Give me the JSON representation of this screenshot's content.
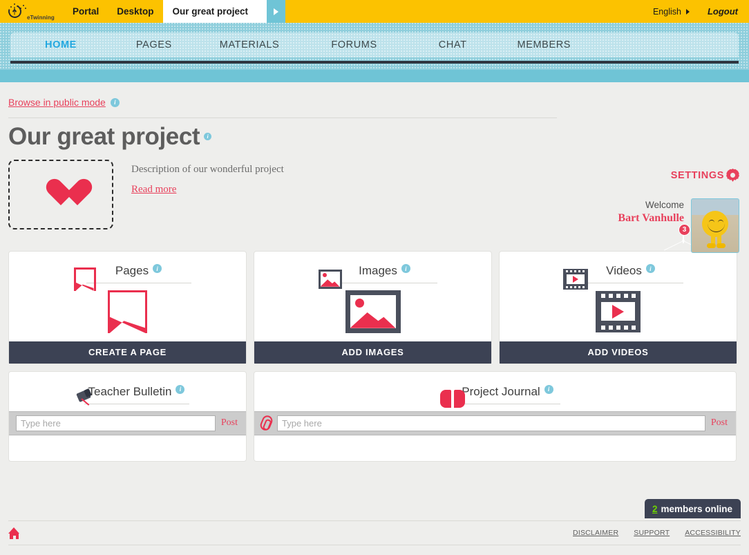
{
  "topbar": {
    "logo_text": "eTwinning",
    "items": [
      {
        "label": "Portal"
      },
      {
        "label": "Desktop"
      },
      {
        "label": "Our great project"
      }
    ],
    "tab_arrow_icon": "play-arrow-icon",
    "language": "English",
    "logout": "Logout"
  },
  "mainnav": {
    "items": [
      {
        "label": "HOME",
        "active": true
      },
      {
        "label": "PAGES",
        "active": false
      },
      {
        "label": "MATERIALS",
        "active": false
      },
      {
        "label": "FORUMS",
        "active": false
      },
      {
        "label": "CHAT",
        "active": false
      },
      {
        "label": "MEMBERS",
        "active": false
      }
    ]
  },
  "page": {
    "browse_link": "Browse in public mode",
    "browse_info": "i",
    "settings_label": "SETTINGS",
    "settings_icon": "gear-icon",
    "title": "Our great project",
    "title_info": "i",
    "cover_icon": "heart-icon",
    "description": "Description of our wonderful project",
    "read_more": "Read more"
  },
  "welcome": {
    "greeting": "Welcome",
    "name": "Bart Vanhulle",
    "messages_icon": "envelope-icon",
    "messages_count": "3",
    "avatar_icon": "avatar"
  },
  "cards": [
    {
      "title": "Pages",
      "info": "i",
      "icon": "pages-icon",
      "cta": "CREATE A PAGE"
    },
    {
      "title": "Images",
      "info": "i",
      "icon": "image-icon",
      "cta": "ADD IMAGES"
    },
    {
      "title": "Videos",
      "info": "i",
      "icon": "video-icon",
      "cta": "ADD VIDEOS"
    }
  ],
  "panels": [
    {
      "title": "Teacher Bulletin",
      "info": "i",
      "icon": "pushpin-icon",
      "input_placeholder": "Type here",
      "input_value": "",
      "post_label": "Post"
    },
    {
      "title": "Project Journal",
      "info": "i",
      "icon": "open-book-icon",
      "attach_icon": "paperclip-icon",
      "input_placeholder": "Type here",
      "input_value": "",
      "post_label": "Post"
    }
  ],
  "footer": {
    "members_count": "2",
    "members_label": "members online",
    "home_icon": "home-icon",
    "links": [
      {
        "label": "DISCLAIMER"
      },
      {
        "label": "SUPPORT"
      },
      {
        "label": "ACCESSIBILITY"
      }
    ]
  },
  "colors": {
    "brand_yellow": "#fcc200",
    "brand_red": "#e8415c",
    "brand_blue": "#6fc4d6",
    "nav_active": "#23a8e0",
    "dark_panel": "#3c4254",
    "online_green": "#6cd400"
  }
}
